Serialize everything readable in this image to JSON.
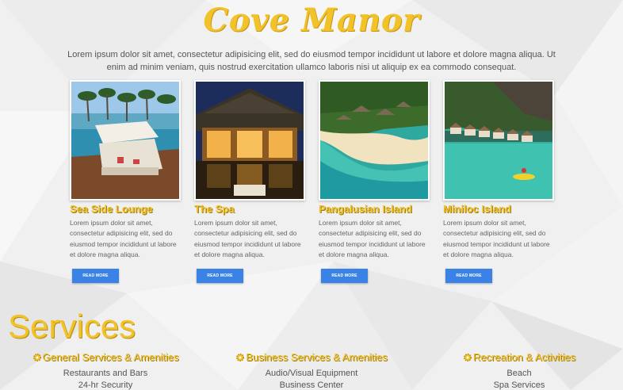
{
  "brand": {
    "title": "Cove Manor"
  },
  "intro": "Lorem ipsum dolor sit amet, consectetur adipisicing elit, sed do eiusmod tempor incididunt ut labore et dolore magna aliqua. Ut enim ad minim veniam, quis nostrud exercitation ullamco laboris nisi ut aliquip ex ea commodo consequat.",
  "cards": [
    {
      "title": "Sea Side Lounge",
      "text": "Lorem ipsum dolor sit amet, consectetur adipisicing elit, sed do eiusmod tempor incididunt ut labore et dolore magna aliqua.",
      "button": "READ MORE"
    },
    {
      "title": "The Spa",
      "text": "Lorem ipsum dolor sit amet, consectetur adipisicing elit, sed do eiusmod tempor incididunt ut labore et dolore magna aliqua.",
      "button": "READ MORE"
    },
    {
      "title": "Pangalusian Island",
      "text": "Lorem ipsum dolor sit amet, consectetur adipisicing elit, sed do eiusmod tempor incididunt ut labore et dolore magna aliqua.",
      "button": "READ MORE"
    },
    {
      "title": "Miniloc Island",
      "text": "Lorem ipsum dolor sit amet, consectetur adipisicing elit, sed do eiusmod tempor incididunt ut labore et dolore magna aliqua.",
      "button": "READ MORE"
    }
  ],
  "services": {
    "title": "Services",
    "columns": [
      {
        "heading": "General Services & Amenities",
        "items": [
          "Restaurants and Bars",
          "24-hr Security"
        ]
      },
      {
        "heading": "Business Services & Amenities",
        "items": [
          "Audio/Visual Equipment",
          "Business Center"
        ]
      },
      {
        "heading": "Recreation & Activities",
        "items": [
          "Beach",
          "Spa Services"
        ]
      }
    ]
  },
  "colors": {
    "accent": "#f2c229",
    "button": "#3b82e6",
    "background": "#f1f1f1"
  }
}
